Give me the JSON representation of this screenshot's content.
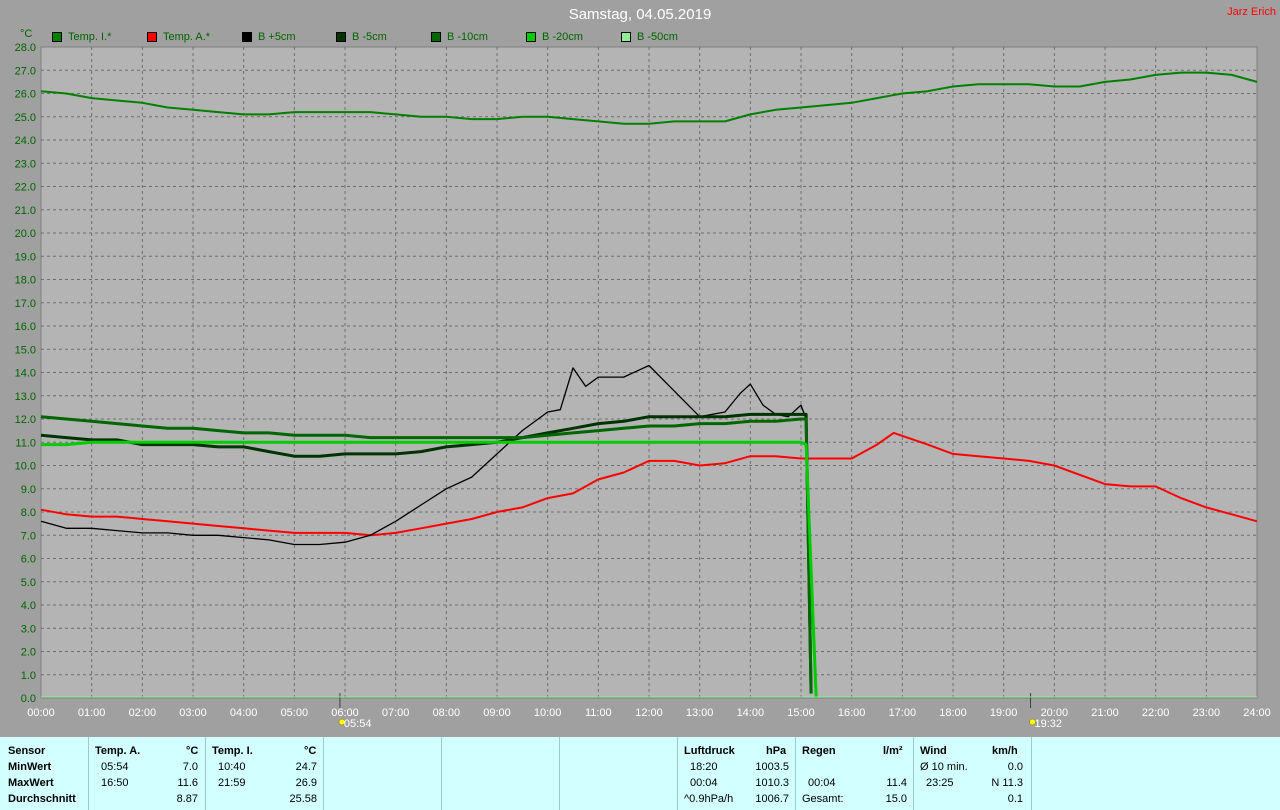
{
  "page_title": "Samstag, 04.05.2019",
  "author": "Jarz Erich",
  "legend": [
    {
      "label": "Temp. I.*",
      "color": "#008000"
    },
    {
      "label": "Temp. A.*",
      "color": "#ff0000"
    },
    {
      "label": "B +5cm",
      "color": "#000000"
    },
    {
      "label": "B -5cm",
      "color": "#003300"
    },
    {
      "label": "B -10cm",
      "color": "#006600"
    },
    {
      "label": "B -20cm",
      "color": "#00cc00"
    },
    {
      "label": "B -50cm",
      "color": "#90ee90"
    }
  ],
  "chart_data": {
    "type": "line",
    "ylabel": "°C",
    "ylim": [
      0,
      28
    ],
    "y_ticks": [
      "0.0",
      "1.0",
      "2.0",
      "3.0",
      "4.0",
      "5.0",
      "6.0",
      "7.0",
      "8.0",
      "9.0",
      "10.0",
      "11.0",
      "12.0",
      "13.0",
      "14.0",
      "15.0",
      "16.0",
      "17.0",
      "18.0",
      "19.0",
      "20.0",
      "21.0",
      "22.0",
      "23.0",
      "24.0",
      "25.0",
      "26.0",
      "27.0",
      "28.0"
    ],
    "x_ticks": [
      "00:00",
      "01:00",
      "02:00",
      "03:00",
      "04:00",
      "05:00",
      "06:00",
      "07:00",
      "08:00",
      "09:00",
      "10:00",
      "11:00",
      "12:00",
      "13:00",
      "14:00",
      "15:00",
      "16:00",
      "17:00",
      "18:00",
      "19:00",
      "20:00",
      "21:00",
      "22:00",
      "23:00",
      "24:00"
    ],
    "xlim": [
      0,
      24
    ],
    "grid": true,
    "markers": [
      {
        "label": "05:54",
        "x": 5.9
      },
      {
        "label": "19:32",
        "x": 19.53
      }
    ],
    "series": [
      {
        "name": "Temp. I.*",
        "color": "#008000",
        "x": [
          0,
          0.5,
          1,
          1.5,
          2,
          2.5,
          3,
          3.5,
          4,
          4.5,
          5,
          5.5,
          6,
          6.5,
          7,
          7.5,
          8,
          8.5,
          9,
          9.5,
          10,
          10.5,
          11,
          11.5,
          12,
          12.5,
          13,
          13.5,
          14,
          14.5,
          15,
          15.5,
          16,
          16.5,
          17,
          17.5,
          18,
          18.5,
          19,
          19.5,
          20,
          20.5,
          21,
          21.5,
          22,
          22.5,
          23,
          23.5,
          24
        ],
        "values": [
          26.1,
          26.0,
          25.8,
          25.7,
          25.6,
          25.4,
          25.3,
          25.2,
          25.1,
          25.1,
          25.2,
          25.2,
          25.2,
          25.2,
          25.1,
          25.0,
          25.0,
          24.9,
          24.9,
          25.0,
          25.0,
          24.9,
          24.8,
          24.7,
          24.7,
          24.8,
          24.8,
          24.8,
          25.1,
          25.3,
          25.4,
          25.5,
          25.6,
          25.8,
          26.0,
          26.1,
          26.3,
          26.4,
          26.4,
          26.4,
          26.3,
          26.3,
          26.5,
          26.6,
          26.8,
          26.9,
          26.9,
          26.8,
          26.5
        ]
      },
      {
        "name": "Temp. A.*",
        "color": "#ff0000",
        "x": [
          0,
          0.5,
          1,
          1.5,
          2,
          2.5,
          3,
          3.5,
          4,
          4.5,
          5,
          5.5,
          6,
          6.5,
          7,
          7.5,
          8,
          8.5,
          9,
          9.5,
          10,
          10.5,
          11,
          11.5,
          12,
          12.5,
          13,
          13.5,
          14,
          14.5,
          15,
          15.5,
          16,
          16.5,
          16.83,
          17.5,
          18,
          18.5,
          19,
          19.5,
          20,
          20.5,
          21,
          21.5,
          22,
          22.5,
          23,
          23.5,
          24
        ],
        "values": [
          8.1,
          7.9,
          7.8,
          7.8,
          7.7,
          7.6,
          7.5,
          7.4,
          7.3,
          7.2,
          7.1,
          7.1,
          7.1,
          7.0,
          7.1,
          7.3,
          7.5,
          7.7,
          8.0,
          8.2,
          8.6,
          8.8,
          9.4,
          9.7,
          10.2,
          10.2,
          10.0,
          10.1,
          10.4,
          10.4,
          10.3,
          10.3,
          10.3,
          10.9,
          11.4,
          10.9,
          10.5,
          10.4,
          10.3,
          10.2,
          10.0,
          9.6,
          9.2,
          9.1,
          9.1,
          8.6,
          8.2,
          7.9,
          7.6
        ]
      },
      {
        "name": "B +5cm",
        "color": "#000000",
        "x": [
          0,
          0.5,
          1,
          1.5,
          2,
          2.5,
          3,
          3.5,
          4,
          4.5,
          5,
          5.5,
          6,
          6.5,
          7,
          7.5,
          8,
          8.5,
          9,
          9.5,
          10,
          10.25,
          10.5,
          10.75,
          11,
          11.5,
          12,
          12.5,
          13,
          13.5,
          13.8,
          14,
          14.25,
          14.5,
          14.75,
          15,
          15.1,
          15.2
        ],
        "values": [
          7.6,
          7.3,
          7.3,
          7.2,
          7.1,
          7.1,
          7.0,
          7.0,
          6.9,
          6.8,
          6.6,
          6.6,
          6.7,
          7.0,
          7.6,
          8.3,
          9.0,
          9.5,
          10.5,
          11.5,
          12.3,
          12.4,
          14.2,
          13.4,
          13.8,
          13.8,
          14.3,
          13.2,
          12.1,
          12.3,
          13.1,
          13.5,
          12.6,
          12.2,
          12.1,
          12.6,
          12.0,
          0.2
        ]
      },
      {
        "name": "B -5cm",
        "color": "#003300",
        "x": [
          0,
          0.5,
          1,
          1.5,
          2,
          2.5,
          3,
          3.5,
          4,
          4.5,
          5,
          5.5,
          6,
          6.5,
          7,
          7.5,
          8,
          8.5,
          9,
          9.5,
          10,
          10.5,
          11,
          11.5,
          12,
          12.5,
          13,
          13.5,
          14,
          14.5,
          15,
          15.1,
          15.2
        ],
        "values": [
          11.3,
          11.2,
          11.1,
          11.1,
          10.9,
          10.9,
          10.9,
          10.8,
          10.8,
          10.6,
          10.4,
          10.4,
          10.5,
          10.5,
          10.5,
          10.6,
          10.8,
          10.9,
          11.0,
          11.2,
          11.4,
          11.6,
          11.8,
          11.9,
          12.1,
          12.1,
          12.1,
          12.1,
          12.2,
          12.2,
          12.2,
          12.2,
          0.2
        ]
      },
      {
        "name": "B -10cm",
        "color": "#006600",
        "x": [
          0,
          0.5,
          1,
          1.5,
          2,
          2.5,
          3,
          3.5,
          4,
          4.5,
          5,
          5.5,
          6,
          6.5,
          7,
          7.5,
          8,
          8.5,
          9,
          9.5,
          10,
          10.5,
          11,
          11.5,
          12,
          12.5,
          13,
          13.5,
          14,
          14.5,
          15,
          15.1,
          15.2
        ],
        "values": [
          12.1,
          12.0,
          11.9,
          11.8,
          11.7,
          11.6,
          11.6,
          11.5,
          11.4,
          11.4,
          11.3,
          11.3,
          11.3,
          11.2,
          11.2,
          11.2,
          11.2,
          11.2,
          11.2,
          11.2,
          11.3,
          11.4,
          11.5,
          11.6,
          11.7,
          11.7,
          11.8,
          11.8,
          11.9,
          11.9,
          12.0,
          12.0,
          0.2
        ]
      },
      {
        "name": "B -20cm",
        "color": "#00cc00",
        "x": [
          0,
          0.5,
          1,
          2,
          3,
          4,
          5,
          6,
          7,
          8,
          9,
          10,
          11,
          12,
          13,
          14,
          14.5,
          15,
          15.1,
          15.3
        ],
        "values": [
          10.9,
          10.9,
          11.0,
          11.0,
          11.0,
          11.0,
          11.0,
          11.0,
          11.0,
          11.0,
          11.0,
          11.0,
          11.0,
          11.0,
          11.0,
          11.0,
          11.0,
          11.0,
          10.9,
          0.0
        ]
      },
      {
        "name": "B -50cm",
        "color": "#90ee90",
        "x": [],
        "values": []
      }
    ]
  },
  "table": {
    "row_labels": [
      "Sensor",
      "MinWert",
      "MaxWert",
      "Durchschnitt"
    ],
    "temp_a": {
      "header": "Temp. A.",
      "unit": "°C",
      "min_time": "05:54",
      "min_val": "7.0",
      "max_time": "16:50",
      "max_val": "11.6",
      "avg": "8.87"
    },
    "temp_i": {
      "header": "Temp. I.",
      "unit": "°C",
      "min_time": "10:40",
      "min_val": "24.7",
      "max_time": "21:59",
      "max_val": "26.9",
      "avg": "25.58"
    },
    "pressure": {
      "header": "Luftdruck",
      "unit": "hPa",
      "min_time": "18:20",
      "min_val": "1003.5",
      "max_time": "00:04",
      "max_val": "1010.3",
      "trend": "^0.9hPa/h",
      "current": "1006.7"
    },
    "rain": {
      "header": "Regen",
      "unit": "l/m²",
      "max_time": "00:04",
      "max_val": "11.4",
      "total_label": "Gesamt:",
      "total": "15.0"
    },
    "wind": {
      "header": "Wind",
      "unit": "km/h",
      "avg_label": "Ø 10 min.",
      "avg": "0.0",
      "max_time": "23:25",
      "max_val": "N 11.3",
      "value3": "0.1"
    }
  }
}
